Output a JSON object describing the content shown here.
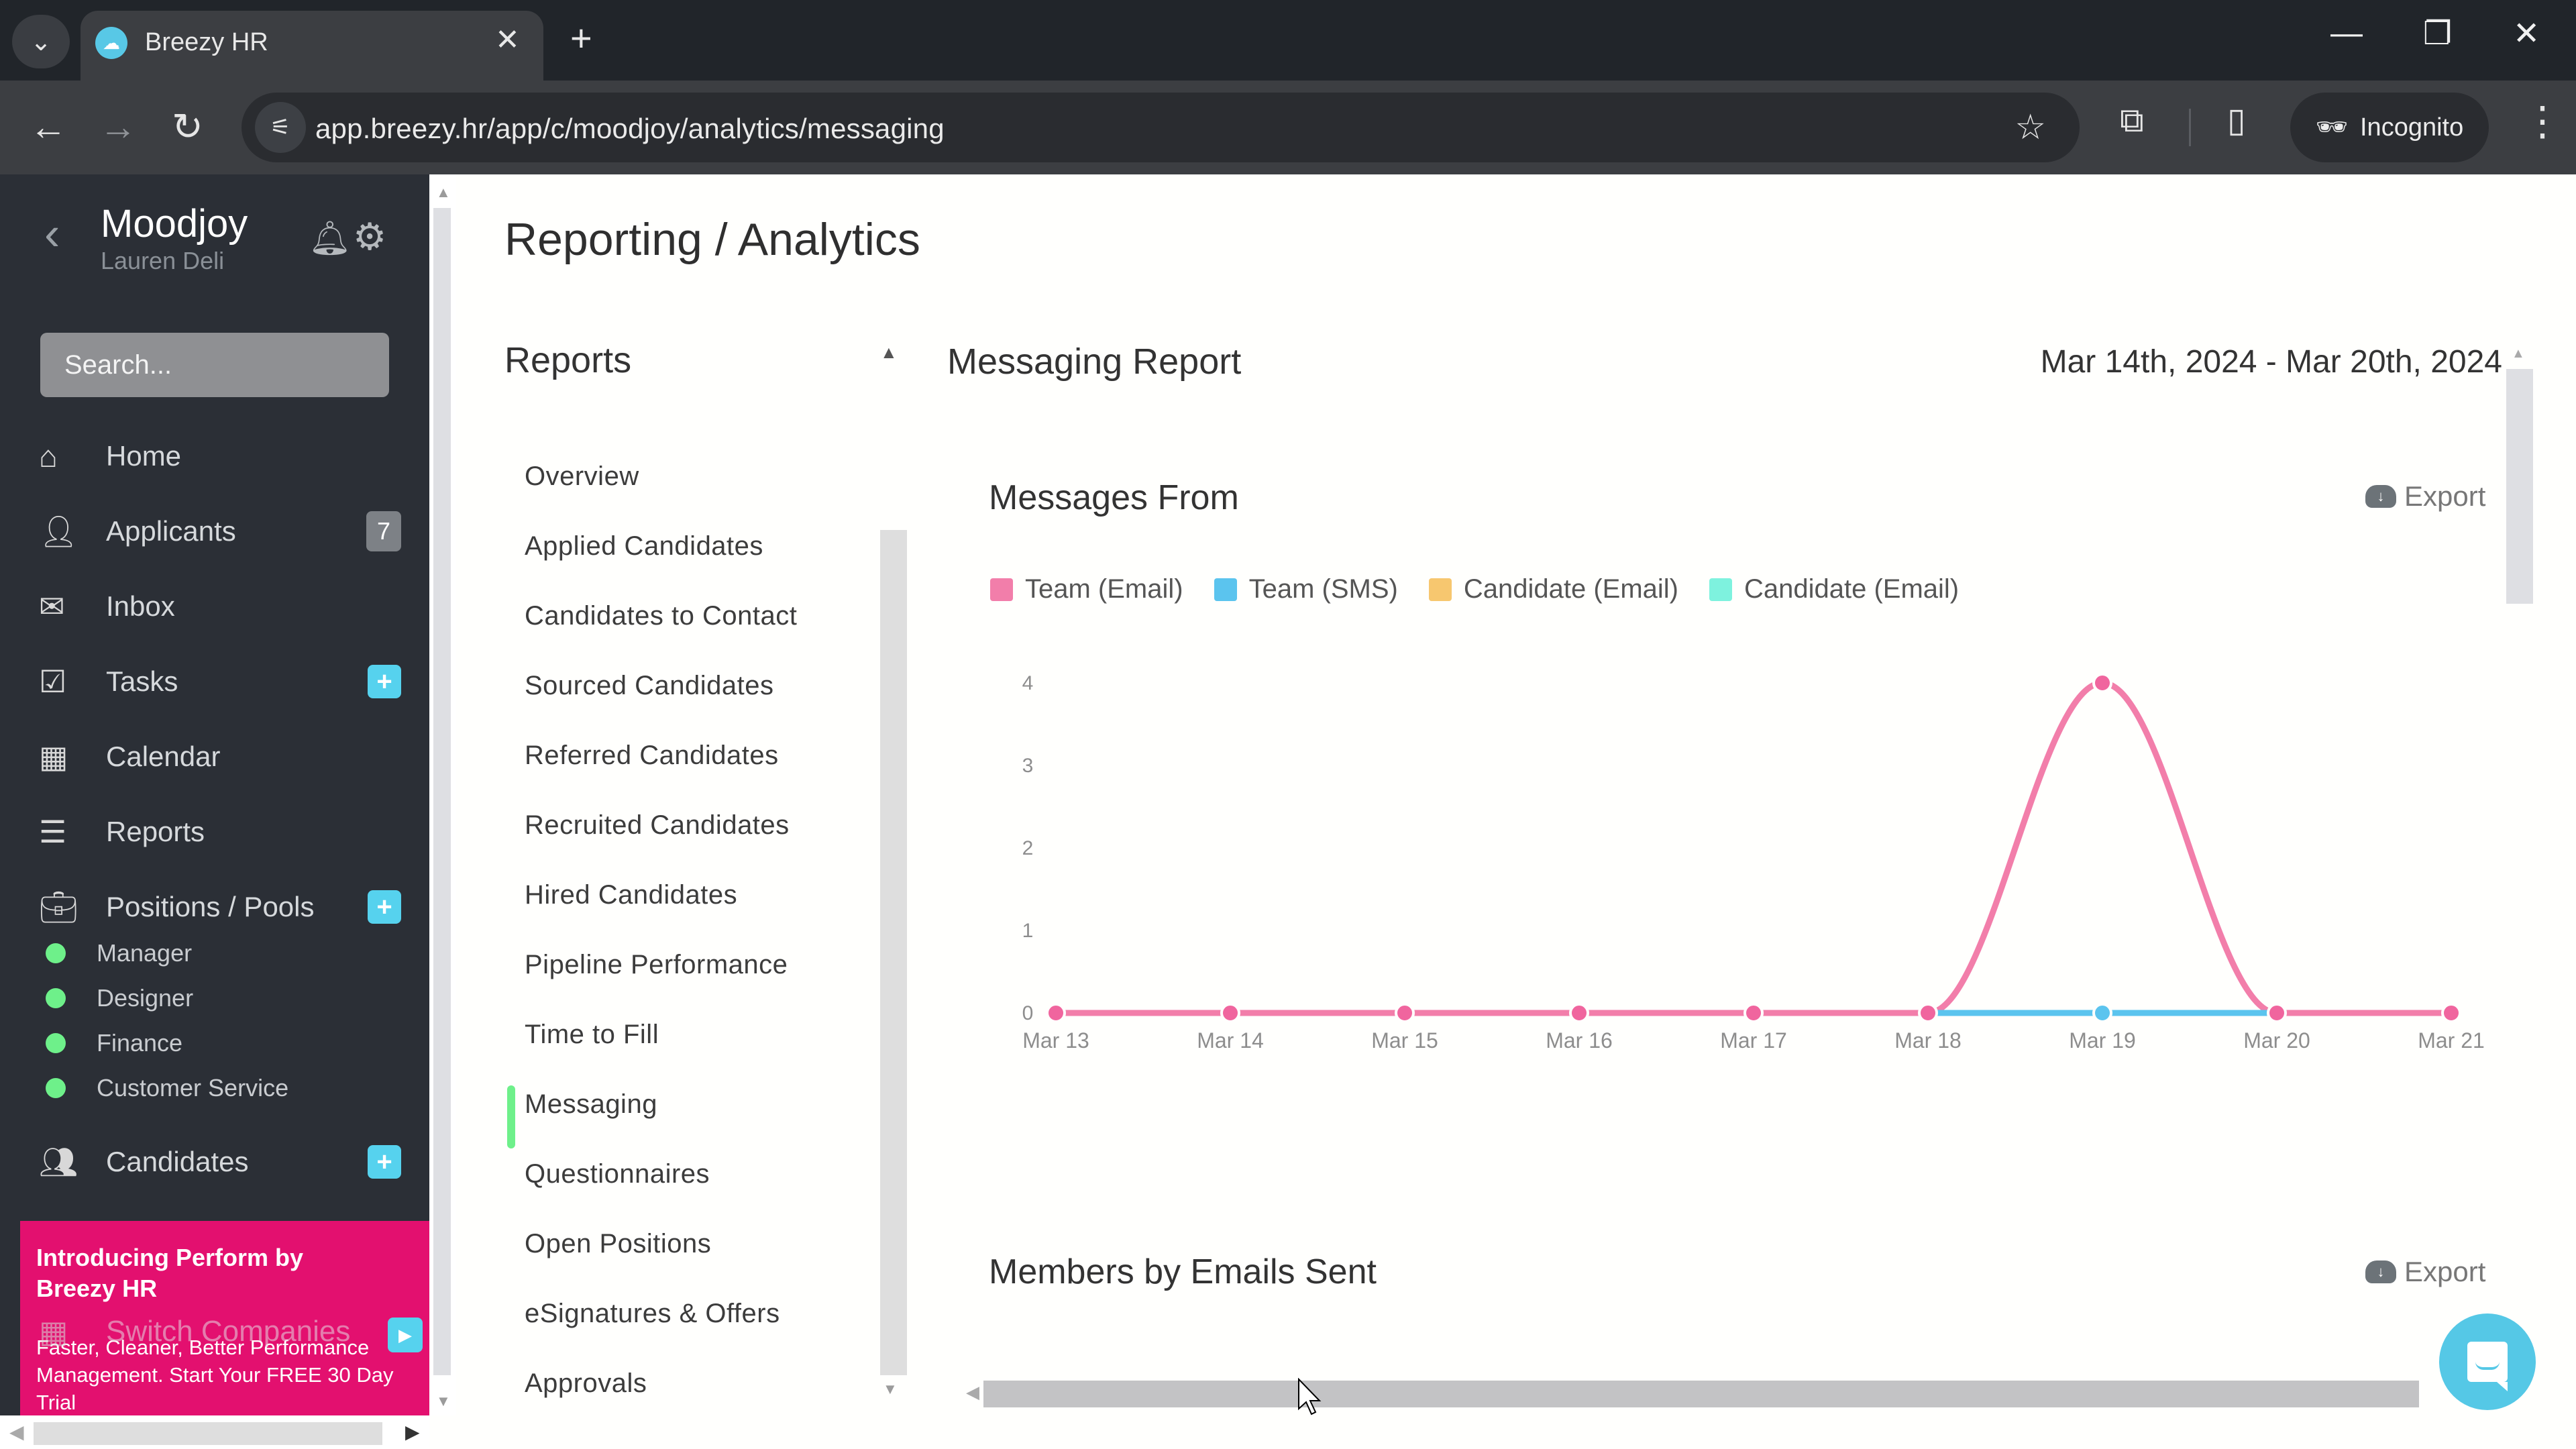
{
  "browser": {
    "tab_title": "Breezy HR",
    "url": "app.breezy.hr/app/c/moodjoy/analytics/messaging",
    "profile_label": "Incognito"
  },
  "sidebar": {
    "company": "Moodjoy",
    "user": "Lauren Deli",
    "search_placeholder": "Search...",
    "nav": [
      {
        "label": "Home",
        "icon": "home-icon"
      },
      {
        "label": "Applicants",
        "icon": "user-icon",
        "badge": "7"
      },
      {
        "label": "Inbox",
        "icon": "envelope-icon"
      },
      {
        "label": "Tasks",
        "icon": "checkbox-icon",
        "add": "+"
      },
      {
        "label": "Calendar",
        "icon": "calendar-icon"
      },
      {
        "label": "Reports",
        "icon": "bar-chart-icon"
      },
      {
        "label": "Positions / Pools",
        "icon": "briefcase-icon",
        "add": "+"
      }
    ],
    "pools": [
      "Manager",
      "Designer",
      "Finance",
      "Customer Service"
    ],
    "candidates": {
      "label": "Candidates",
      "add": "+"
    },
    "switch_companies": "Switch Companies",
    "promo": {
      "title": "Introducing Perform by Breezy HR",
      "body": "Faster, Cleaner, Better Performance Management. Start Your FREE 30 Day Trial"
    }
  },
  "main": {
    "page_title": "Reporting / Analytics",
    "reports_heading": "Reports",
    "report_nav": [
      "Overview",
      "Applied Candidates",
      "Candidates to Contact",
      "Sourced Candidates",
      "Referred Candidates",
      "Recruited Candidates",
      "Hired Candidates",
      "Pipeline Performance",
      "Time to Fill",
      "Messaging",
      "Questionnaires",
      "Open Positions",
      "eSignatures & Offers",
      "Approvals"
    ],
    "active_report": "Messaging",
    "report_title": "Messaging Report",
    "date_range": "Mar 14th, 2024 - Mar 20th, 2024",
    "export_label": "Export",
    "members_title": "Members by Emails Sent"
  },
  "chart_data": {
    "type": "line",
    "title": "Messages From",
    "xlabel": "",
    "ylabel": "",
    "x": [
      "Mar 13",
      "Mar 14",
      "Mar 15",
      "Mar 16",
      "Mar 17",
      "Mar 18",
      "Mar 19",
      "Mar 20",
      "Mar 21"
    ],
    "yticks": [
      0,
      1,
      2,
      3,
      4
    ],
    "ylim": [
      0,
      4
    ],
    "grid": false,
    "legend_position": "top-left",
    "smooth": true,
    "series": [
      {
        "name": "Team (Email)",
        "color": "#f27eaa",
        "values": [
          0,
          0,
          0,
          0,
          0,
          0,
          4,
          0,
          0
        ]
      },
      {
        "name": "Team (SMS)",
        "color": "#5bc4ee",
        "values": [
          0,
          0,
          0,
          0,
          0,
          0,
          0,
          0,
          0
        ]
      },
      {
        "name": "Candidate (Email)",
        "color": "#f7c76f",
        "values": [
          0,
          0,
          0,
          0,
          0,
          0,
          0,
          0,
          0
        ]
      },
      {
        "name": "Candidate (Email)",
        "color": "#7ef2de",
        "values": [
          0,
          0,
          0,
          0,
          0,
          0,
          0,
          0,
          0
        ]
      }
    ]
  }
}
